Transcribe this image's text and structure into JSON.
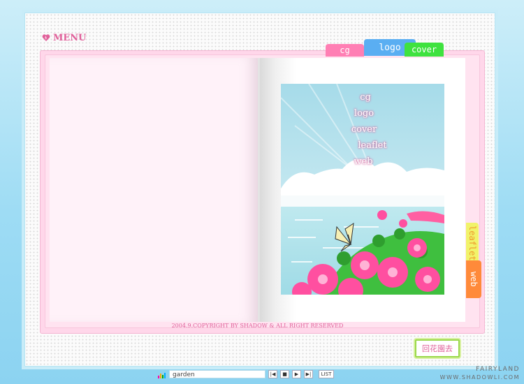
{
  "menu": {
    "title": "MENU",
    "icon": "heart-icon"
  },
  "tabs": [
    {
      "id": "cg",
      "label": "cg",
      "color": "#ff7fb4"
    },
    {
      "id": "logo",
      "label": "logo",
      "color": "#5aaef2"
    },
    {
      "id": "cover",
      "label": "cover",
      "color": "#3fe23f"
    }
  ],
  "side_tabs": [
    {
      "id": "leaflet",
      "label": "leaflet",
      "color": "#f1f36a"
    },
    {
      "id": "web",
      "label": "web",
      "color": "#ff8a3a"
    }
  ],
  "art_links": [
    "cg",
    "logo",
    "cover",
    "leaflet",
    "web"
  ],
  "copyright": "2004.9.COPYRIGHT BY SHADOW & ALL RIGHT RESERVED",
  "home_button": "回花園去",
  "branding": {
    "line1": "FAIRYLAND",
    "line2": "WWW.SHADOWLI.COM"
  },
  "player": {
    "track": "garden",
    "list_label": "LIST"
  },
  "colors": {
    "accent": "#e0609a",
    "book": "#ffd7ea",
    "sky": "#9edcf4"
  }
}
